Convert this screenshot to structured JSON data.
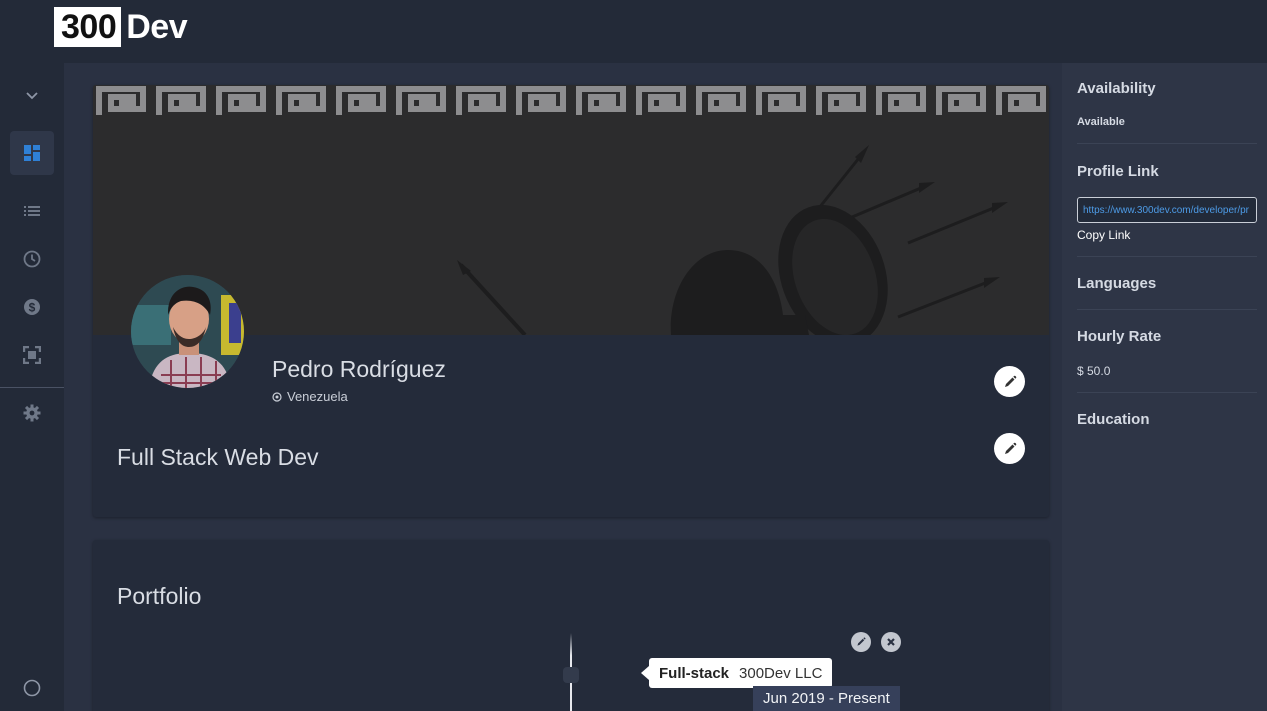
{
  "brand": {
    "box_text": "300",
    "text": "Dev"
  },
  "sidebar": {
    "items": [
      {
        "icon": "chevron-down-icon"
      },
      {
        "icon": "dashboard-icon",
        "active": true
      },
      {
        "icon": "list-icon"
      },
      {
        "icon": "clock-icon"
      },
      {
        "icon": "dollar-icon"
      },
      {
        "icon": "expand-icon"
      },
      {
        "icon": "gear-icon"
      },
      {
        "icon": "circle-icon"
      }
    ]
  },
  "profile": {
    "name": "Pedro Rodríguez",
    "location": "Venezuela",
    "title": "Full Stack Web Dev"
  },
  "portfolio": {
    "heading": "Portfolio",
    "entries": [
      {
        "role": "Full-stack",
        "company": "300Dev LLC",
        "dates": "Jun 2019 - Present"
      }
    ]
  },
  "right_panel": {
    "availability": {
      "heading": "Availability",
      "value": "Available"
    },
    "profile_link": {
      "heading": "Profile Link",
      "url": "https://www.300dev.com/developer/pr",
      "copy_label": "Copy Link"
    },
    "languages": {
      "heading": "Languages"
    },
    "hourly_rate": {
      "heading": "Hourly Rate",
      "value": "$ 50.0"
    },
    "education": {
      "heading": "Education"
    }
  },
  "colors": {
    "accent": "#2f80d6",
    "background": "#2a3142",
    "sidebar": "#232a38",
    "card": "#242b3a",
    "link": "#4d9be6"
  }
}
